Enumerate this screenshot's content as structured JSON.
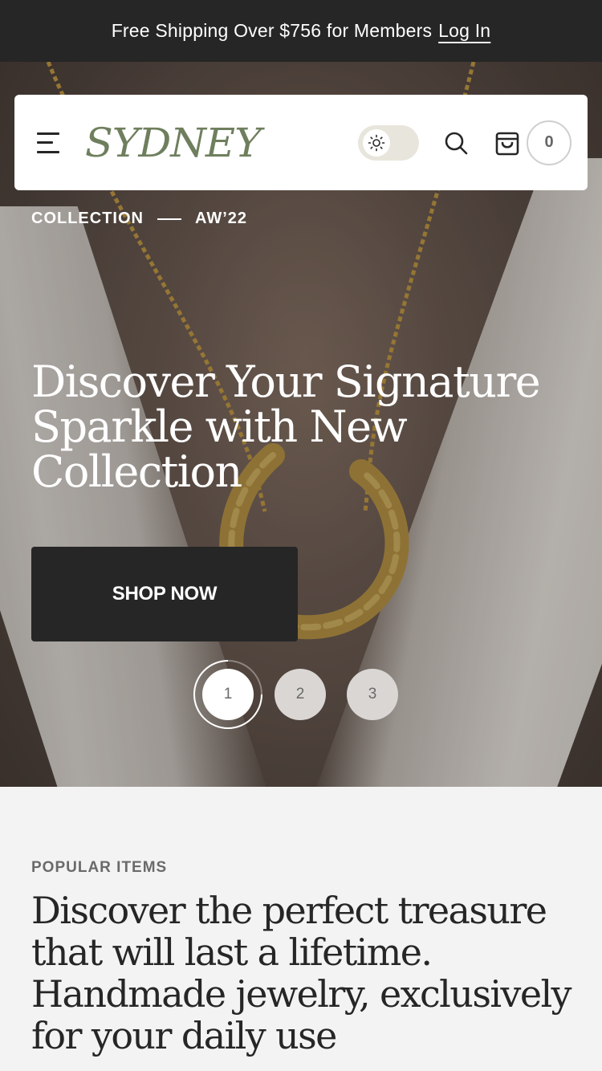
{
  "announcement": {
    "text": "Free Shipping Over $756 for Members",
    "login_label": "Log In"
  },
  "header": {
    "logo": "SYDNEY",
    "icons": {
      "menu": "hamburger-menu-icon",
      "theme_toggle": "sun-icon",
      "search": "search-icon",
      "cart": "shopping-bag-icon"
    },
    "cart_count": "0"
  },
  "hero": {
    "eyebrow_left": "COLLECTION",
    "eyebrow_right": "AW’22",
    "title": "Discover Your Signature Sparkle with New Collection",
    "cta_label": "SHOP NOW",
    "slides": [
      "1",
      "2",
      "3"
    ],
    "active_slide": 1
  },
  "popular": {
    "label": "POPULAR ITEMS",
    "heading": "Discover the perfect treasure that will last a lifetime. Handmade jewelry, exclusively for your daily use"
  },
  "colors": {
    "dark": "#262626",
    "brand_green": "#6f7f5e",
    "toggle_bg": "#e8e5dc",
    "section_bg": "#f3f3f3"
  }
}
